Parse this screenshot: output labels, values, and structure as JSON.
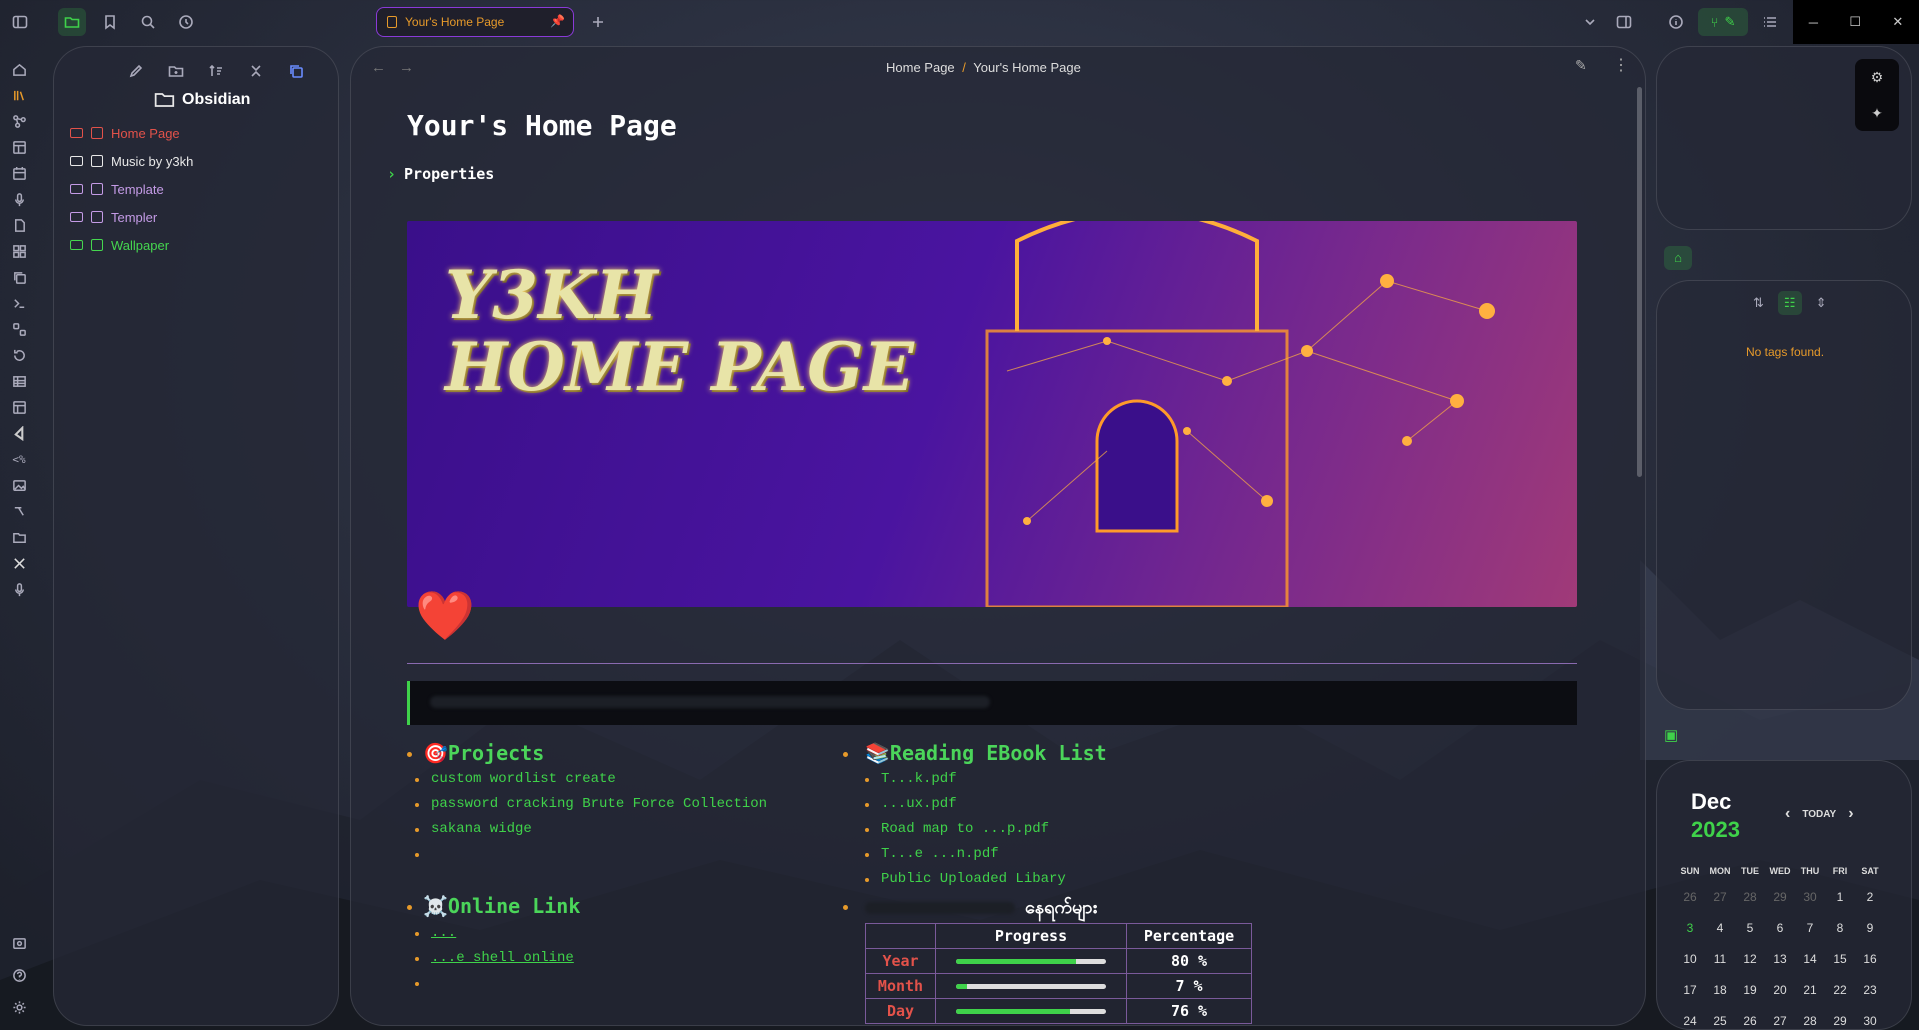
{
  "tab": {
    "title": "Your's Home Page"
  },
  "breadcrumb": {
    "parent": "Home Page",
    "sep": "/",
    "current": "Your's Home Page"
  },
  "vault": {
    "name": "Obsidian"
  },
  "tree": [
    {
      "label": "Home Page",
      "icon": "house-emoji",
      "color": "#e2524a"
    },
    {
      "label": "Music by y3kh",
      "icon": "image-emoji",
      "color": "#e8e8e8"
    },
    {
      "label": "Template",
      "icon": "table-icon",
      "color": "#c49be6"
    },
    {
      "label": "Templer",
      "icon": "table-icon",
      "color": "#c49be6"
    },
    {
      "label": "Wallpaper",
      "icon": "image-icon",
      "color": "#45d64f"
    }
  ],
  "note": {
    "title": "Your's Home Page",
    "properties": "Properties"
  },
  "banner": {
    "line1": "Y3KH",
    "line2": "HOME PAGE"
  },
  "projects": {
    "emoji": "🎯",
    "title": "Projects",
    "items": [
      "custom wordlist create",
      "password cracking Brute Force Collection",
      "sakana widge",
      ""
    ]
  },
  "ebooks": {
    "emoji": "📚",
    "title": "Reading EBook List",
    "items": [
      "T...k.pdf",
      "...ux.pdf",
      "Road map to ...p.pdf",
      "T...e ...n.pdf",
      "Public Uploaded Libary"
    ]
  },
  "online": {
    "emoji": "☠️",
    "title": "Online Link",
    "items": [
      "...",
      "...e shell online",
      ""
    ]
  },
  "myanmar": {
    "title": "နေရက်များ"
  },
  "progress_table": {
    "headers": [
      "",
      "Progress",
      "Percentage"
    ],
    "rows": [
      {
        "label": "Year",
        "value": 80,
        "pct": "80 %"
      },
      {
        "label": "Month",
        "value": 7,
        "pct": "7 %"
      },
      {
        "label": "Day",
        "value": 76,
        "pct": "76 %"
      }
    ]
  },
  "tags": {
    "empty": "No tags found."
  },
  "calendar": {
    "month": "Dec",
    "year": "2023",
    "today": "TODAY",
    "days": [
      "SUN",
      "MON",
      "TUE",
      "WED",
      "THU",
      "FRI",
      "SAT"
    ],
    "weeks": [
      [
        "26",
        "27",
        "28",
        "29",
        "30",
        "1",
        "2"
      ],
      [
        "3",
        "4",
        "5",
        "6",
        "7",
        "8",
        "9"
      ],
      [
        "10",
        "11",
        "12",
        "13",
        "14",
        "15",
        "16"
      ],
      [
        "17",
        "18",
        "19",
        "20",
        "21",
        "22",
        "23"
      ],
      [
        "24",
        "25",
        "26",
        "27",
        "28",
        "29",
        "30"
      ]
    ]
  },
  "colors": {
    "accent": "#3fd24a",
    "orange": "#e79a2a",
    "tab_border": "#8a3ad8",
    "red": "#e2524a"
  }
}
